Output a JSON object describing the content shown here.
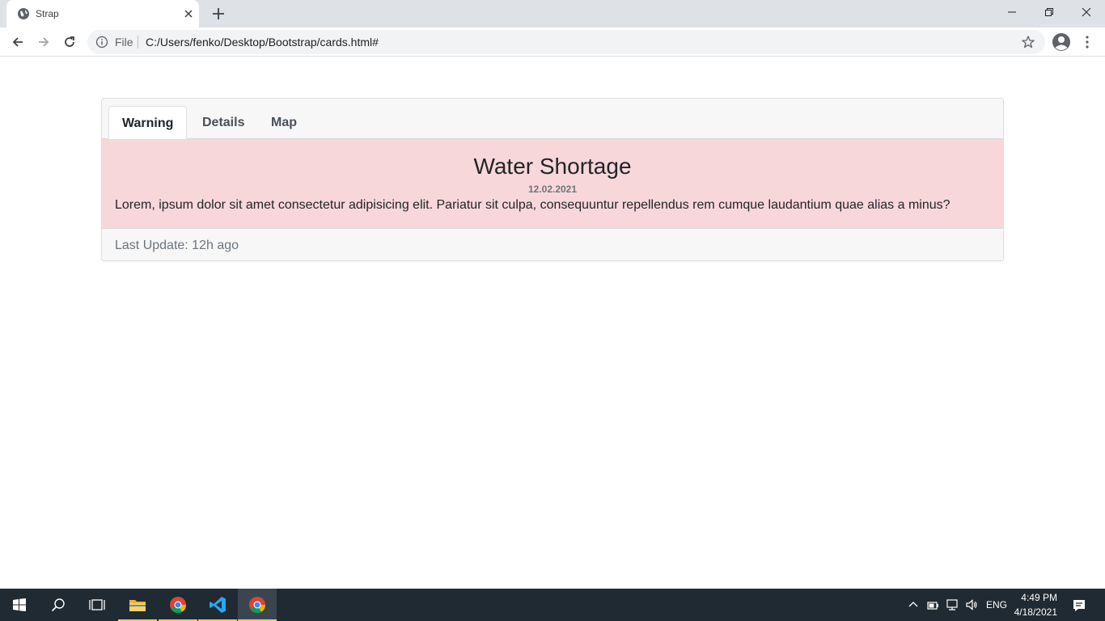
{
  "browser": {
    "tab_title": "Strap",
    "url_scheme_label": "File",
    "url": "C:/Users/fenko/Desktop/Bootstrap/cards.html#"
  },
  "card": {
    "tabs": [
      {
        "label": "Warning",
        "active": true
      },
      {
        "label": "Details",
        "active": false
      },
      {
        "label": "Map",
        "active": false
      }
    ],
    "title": "Water Shortage",
    "subtitle": "12.02.2021",
    "text": "Lorem, ipsum dolor sit amet consectetur adipisicing elit. Pariatur sit culpa, consequuntur repellendus rem cumque laudantium quae alias a minus?",
    "footer": "Last Update: 12h ago",
    "alert_color": "#f8d7da"
  },
  "taskbar": {
    "apps": [
      "start-icon",
      "search-icon",
      "task-view-icon",
      "file-explorer-icon",
      "chrome-icon",
      "vscode-icon",
      "chrome-icon"
    ],
    "language": "ENG",
    "time": "4:49 PM",
    "date": "4/18/2021"
  }
}
